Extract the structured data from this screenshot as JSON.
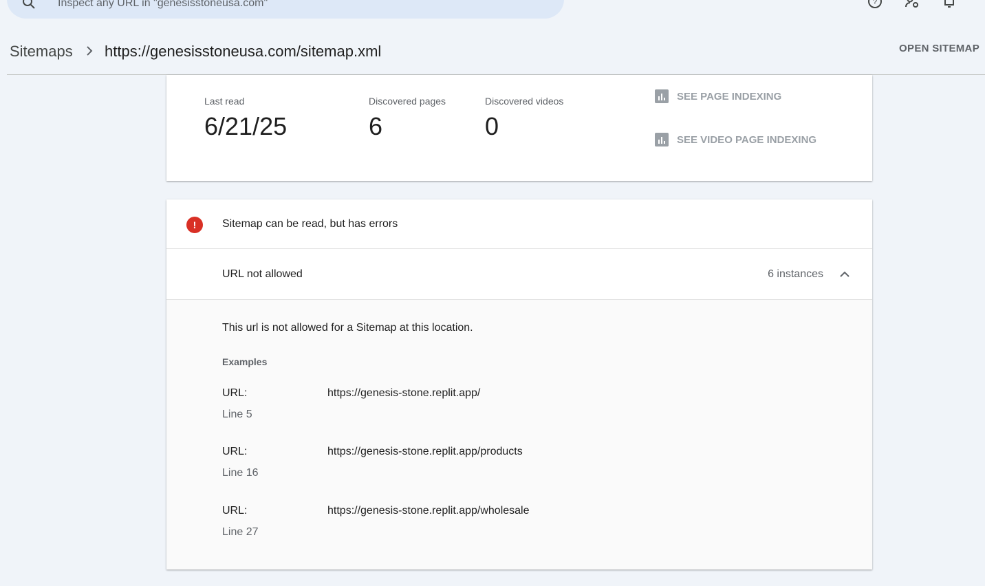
{
  "search": {
    "placeholder": "Inspect any URL in \"genesisstoneusa.com\""
  },
  "icons": {
    "search": "search-icon",
    "help": "help-icon",
    "settings": "manage-users-icon",
    "notifications": "bell-icon",
    "chart": "bar-chart-icon",
    "error": "error-icon",
    "chevron": "chevron-up-icon"
  },
  "breadcrumb": {
    "root": "Sitemaps",
    "current": "https://genesisstoneusa.com/sitemap.xml"
  },
  "header": {
    "open_sitemap": "OPEN SITEMAP"
  },
  "stats": [
    {
      "label": "Last read",
      "value": "6/21/25"
    },
    {
      "label": "Discovered pages",
      "value": "6"
    },
    {
      "label": "Discovered videos",
      "value": "0"
    }
  ],
  "links": {
    "page_indexing": "SEE PAGE INDEXING",
    "video_indexing": "SEE VIDEO PAGE INDEXING"
  },
  "status": {
    "message": "Sitemap can be read, but has errors",
    "color": "#d93025"
  },
  "issue": {
    "name": "URL not allowed",
    "count": "6 instances",
    "description": "This url is not allowed for a Sitemap at this location.",
    "examples_title": "Examples",
    "examples": [
      {
        "key": "URL:",
        "url": "https://genesis-stone.replit.app/",
        "line": "Line 5"
      },
      {
        "key": "URL:",
        "url": "https://genesis-stone.replit.app/products",
        "line": "Line 16"
      },
      {
        "key": "URL:",
        "url": "https://genesis-stone.replit.app/wholesale",
        "line": "Line 27"
      }
    ]
  }
}
